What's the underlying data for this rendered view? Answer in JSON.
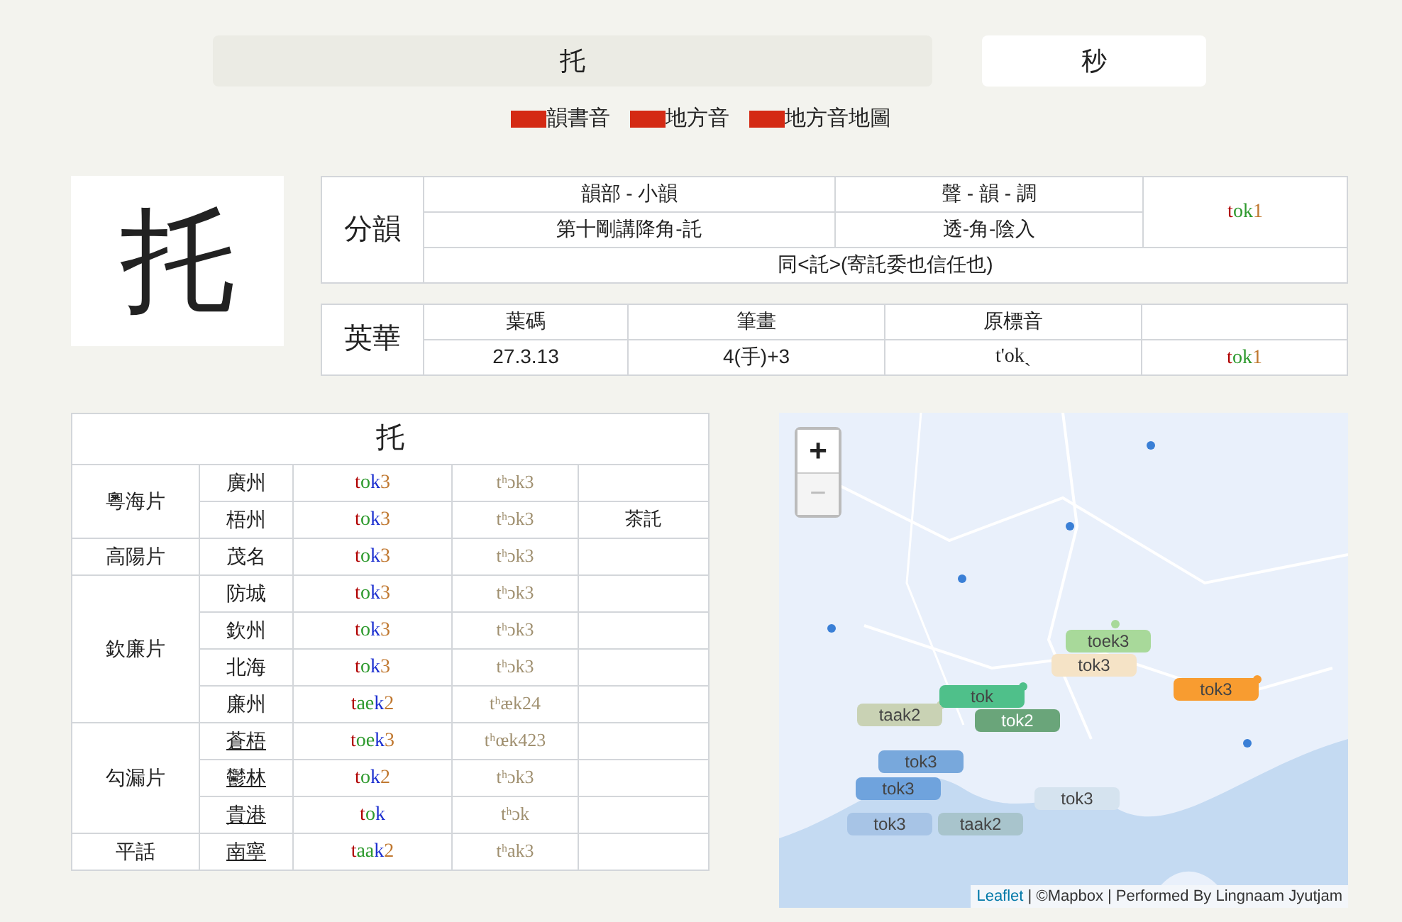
{
  "tabs": [
    {
      "label": "托",
      "selected": true
    },
    {
      "label": "秒",
      "selected": false
    }
  ],
  "legend": [
    "韻書音",
    "地方音",
    "地方音地圖"
  ],
  "character": "托",
  "fenwan": {
    "label": "分韻",
    "headers": [
      "韻部 - 小韻",
      "聲 - 韻 - 調"
    ],
    "values": [
      "第十剛講降角-託",
      "透-角-陰入"
    ],
    "note": "同<託>(寄託委也信任也)",
    "jyutping": [
      {
        "kind": "initial",
        "text": "t"
      },
      {
        "kind": "final",
        "text": "ok"
      },
      {
        "kind": "tone",
        "text": "1"
      }
    ]
  },
  "yingwaa": {
    "label": "英華",
    "headers": [
      "葉碼",
      "筆畫",
      "原標音"
    ],
    "values": [
      "27.3.13",
      "4(手)+3",
      "t'okˏ"
    ],
    "jyutping": [
      {
        "kind": "initial",
        "text": "t"
      },
      {
        "kind": "final",
        "text": "ok"
      },
      {
        "kind": "tone",
        "text": "1"
      }
    ]
  },
  "dialects": {
    "title": "托",
    "groups": [
      {
        "name": "粵海片",
        "rows": [
          {
            "place": "廣州",
            "underlined": false,
            "jyutping": [
              {
                "kind": "initial",
                "text": "t"
              },
              {
                "kind": "nucleus",
                "text": "o"
              },
              {
                "kind": "coda",
                "text": "k"
              },
              {
                "kind": "tone",
                "text": "3"
              }
            ],
            "ipa": "tʰɔk3"
          },
          {
            "place": "梧州",
            "underlined": false,
            "jyutping": [
              {
                "kind": "initial",
                "text": "t"
              },
              {
                "kind": "nucleus",
                "text": "o"
              },
              {
                "kind": "coda",
                "text": "k"
              },
              {
                "kind": "tone",
                "text": "3"
              }
            ],
            "ipa": "tʰɔk3",
            "note": "茶託"
          }
        ]
      },
      {
        "name": "高陽片",
        "rows": [
          {
            "place": "茂名",
            "underlined": false,
            "jyutping": [
              {
                "kind": "initial",
                "text": "t"
              },
              {
                "kind": "nucleus",
                "text": "o"
              },
              {
                "kind": "coda",
                "text": "k"
              },
              {
                "kind": "tone",
                "text": "3"
              }
            ],
            "ipa": "tʰɔk3"
          }
        ]
      },
      {
        "name": "欽廉片",
        "rows": [
          {
            "place": "防城",
            "underlined": false,
            "jyutping": [
              {
                "kind": "initial",
                "text": "t"
              },
              {
                "kind": "nucleus",
                "text": "o"
              },
              {
                "kind": "coda",
                "text": "k"
              },
              {
                "kind": "tone",
                "text": "3"
              }
            ],
            "ipa": "tʰɔk3"
          },
          {
            "place": "欽州",
            "underlined": false,
            "jyutping": [
              {
                "kind": "initial",
                "text": "t"
              },
              {
                "kind": "nucleus",
                "text": "o"
              },
              {
                "kind": "coda",
                "text": "k"
              },
              {
                "kind": "tone",
                "text": "3"
              }
            ],
            "ipa": "tʰɔk3"
          },
          {
            "place": "北海",
            "underlined": false,
            "jyutping": [
              {
                "kind": "initial",
                "text": "t"
              },
              {
                "kind": "nucleus",
                "text": "o"
              },
              {
                "kind": "coda",
                "text": "k"
              },
              {
                "kind": "tone",
                "text": "3"
              }
            ],
            "ipa": "tʰɔk3"
          },
          {
            "place": "廉州",
            "underlined": false,
            "jyutping": [
              {
                "kind": "initial",
                "text": "t"
              },
              {
                "kind": "nucleus",
                "text": "ae"
              },
              {
                "kind": "coda",
                "text": "k"
              },
              {
                "kind": "tone",
                "text": "2"
              }
            ],
            "ipa": "tʰæk24"
          }
        ]
      },
      {
        "name": "勾漏片",
        "rows": [
          {
            "place": "蒼梧",
            "underlined": true,
            "jyutping": [
              {
                "kind": "initial",
                "text": "t"
              },
              {
                "kind": "nucleus",
                "text": "oe"
              },
              {
                "kind": "coda",
                "text": "k"
              },
              {
                "kind": "tone",
                "text": "3"
              }
            ],
            "ipa": "tʰœk423"
          },
          {
            "place": "鬱林",
            "underlined": true,
            "jyutping": [
              {
                "kind": "initial",
                "text": "t"
              },
              {
                "kind": "nucleus",
                "text": "o"
              },
              {
                "kind": "coda",
                "text": "k"
              },
              {
                "kind": "tone",
                "text": "2"
              }
            ],
            "ipa": "tʰɔk3"
          },
          {
            "place": "貴港",
            "underlined": true,
            "jyutping": [
              {
                "kind": "initial",
                "text": "t"
              },
              {
                "kind": "nucleus",
                "text": "o"
              },
              {
                "kind": "coda",
                "text": "k"
              }
            ],
            "ipa": "tʰɔk"
          }
        ]
      },
      {
        "name": "平話",
        "rows": [
          {
            "place": "南寧",
            "underlined": true,
            "jyutping": [
              {
                "kind": "initial",
                "text": "t"
              },
              {
                "kind": "nucleus",
                "text": "aa"
              },
              {
                "kind": "coda",
                "text": "k"
              },
              {
                "kind": "tone",
                "text": "2"
              }
            ],
            "ipa": "tʰak3"
          }
        ]
      }
    ]
  },
  "map": {
    "zoom_in": "+",
    "zoom_out": "−",
    "attribution_link": "Leaflet",
    "attribution": "| ©Mapbox | Performed By Lingnaam Jyutjam",
    "markers": [
      {
        "label": "toek3",
        "color": "#a8d99a"
      },
      {
        "label": "tok3",
        "color": "#f5e3c6"
      },
      {
        "label": "tok3",
        "color": "#f89c30"
      },
      {
        "label": "tok",
        "color": "#4fc08a"
      },
      {
        "label": "tok2",
        "color": "#6aa57a"
      },
      {
        "label": "taak2",
        "color": "#c9d2b4"
      },
      {
        "label": "tok3",
        "color": "#78a8dc"
      },
      {
        "label": "tok3",
        "color": "#6fa3dd"
      },
      {
        "label": "taak2",
        "color": "#a8c4cc"
      },
      {
        "label": "tok3",
        "color": "#a7c4e6"
      },
      {
        "label": "tok3",
        "color": "#d5e3ef"
      }
    ]
  }
}
